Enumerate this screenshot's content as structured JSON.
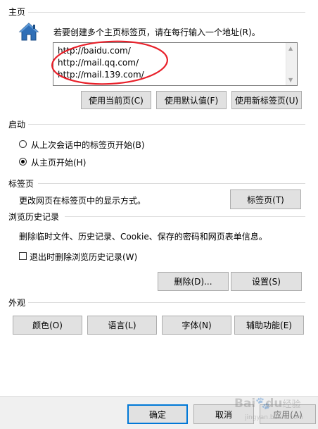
{
  "homepage": {
    "title": "主页",
    "hint": "若要创建多个主页标签页，请在每行输入一个地址(R)。",
    "addresses": [
      "http://baidu.com/",
      "http://mail.qq.com/",
      "http://mail.139.com/"
    ],
    "buttons": {
      "use_current": "使用当前页(C)",
      "use_default": "使用默认值(F)",
      "use_new_tab": "使用新标签页(U)"
    }
  },
  "startup": {
    "title": "启动",
    "option_last_session": "从上次会话中的标签页开始(B)",
    "option_homepage": "从主页开始(H)",
    "selected": "option_homepage"
  },
  "tabs": {
    "title": "标签页",
    "description": "更改网页在标签页中的显示方式。",
    "button": "标签页(T)"
  },
  "history": {
    "title": "浏览历史记录",
    "description": "删除临时文件、历史记录、Cookie、保存的密码和网页表单信息。",
    "checkbox_label": "退出时删除浏览历史记录(W)",
    "checkbox_checked": false,
    "delete_button": "删除(D)...",
    "settings_button": "设置(S)"
  },
  "appearance": {
    "title": "外观",
    "colors_button": "颜色(O)",
    "languages_button": "语言(L)",
    "fonts_button": "字体(N)",
    "accessibility_button": "辅助功能(E)"
  },
  "footer": {
    "ok": "确定",
    "cancel": "取消",
    "apply": "应用(A)"
  },
  "watermark": {
    "brand": "Bai",
    "paw": "du",
    "suffix": "经验",
    "url": "jingyan.baidu.com"
  },
  "colors": {
    "annotation_circle": "#e8202a",
    "primary_border": "#0078d7",
    "home_icon_blue": "#2f6fb7"
  }
}
